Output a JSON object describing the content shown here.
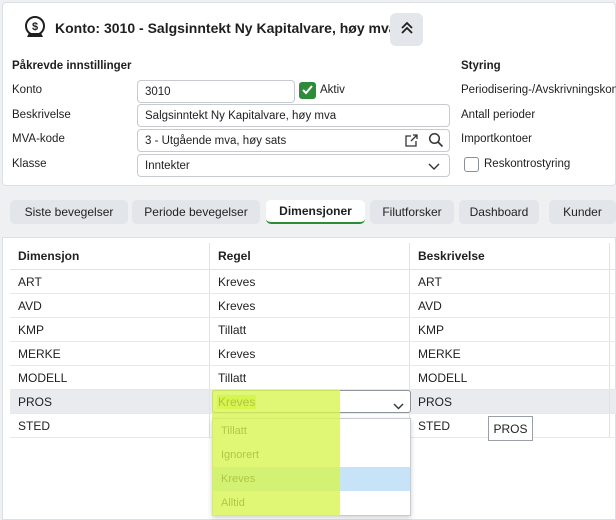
{
  "header": {
    "title": "Konto: 3010 - Salgsinntekt Ny Kapitalvare, høy mva",
    "collapse_icon": "chevron-double-up-icon",
    "account_icon": "money-bag-icon"
  },
  "required": {
    "section_title": "Påkrevde innstillinger",
    "konto_label": "Konto",
    "konto_value": "3010",
    "aktiv_label": "Aktiv",
    "aktiv_checked": true,
    "beskrivelse_label": "Beskrivelse",
    "beskrivelse_value": "Salgsinntekt Ny Kapitalvare, høy mva",
    "mva_label": "MVA-kode",
    "mva_value": "3 - Utgående mva, høy sats",
    "klasse_label": "Klasse",
    "klasse_value": "Inntekter"
  },
  "styring": {
    "section_title": "Styring",
    "periodisering_label": "Periodisering-/Avskrivningskont",
    "antall_label": "Antall perioder",
    "importkontoer_label": "Importkontoer",
    "reskontro_label": "Reskontrostyring",
    "reskontro_checked": false
  },
  "tabs": [
    {
      "label": "Siste bevegelser"
    },
    {
      "label": "Periode bevegelser"
    },
    {
      "label": "Dimensjoner"
    },
    {
      "label": "Filutforsker"
    },
    {
      "label": "Dashboard"
    },
    {
      "label": "Kunder"
    }
  ],
  "active_tab": "Dimensjoner",
  "grid": {
    "columns": [
      "Dimensjon",
      "Regel",
      "Beskrivelse"
    ],
    "rows": [
      {
        "dimensjon": "ART",
        "regel": "Kreves",
        "beskrivelse": "ART"
      },
      {
        "dimensjon": "AVD",
        "regel": "Kreves",
        "beskrivelse": "AVD"
      },
      {
        "dimensjon": "KMP",
        "regel": "Tillatt",
        "beskrivelse": "KMP"
      },
      {
        "dimensjon": "MERKE",
        "regel": "Kreves",
        "beskrivelse": "MERKE"
      },
      {
        "dimensjon": "MODELL",
        "regel": "Tillatt",
        "beskrivelse": "MODELL"
      },
      {
        "dimensjon": "PROS",
        "regel": "Kreves",
        "beskrivelse": "PROS"
      },
      {
        "dimensjon": "STED",
        "regel": "",
        "beskrivelse": "STED"
      }
    ]
  },
  "editor": {
    "value": "Kreves",
    "options": [
      "Tillatt",
      "Ignorert",
      "Kreves",
      "Alltid"
    ],
    "hovered": "Kreves"
  },
  "tooltip": "PROS",
  "colors": {
    "accent": "#2e8b3a",
    "highlight": "#d6f54e",
    "hover": "#c6e3f7"
  }
}
